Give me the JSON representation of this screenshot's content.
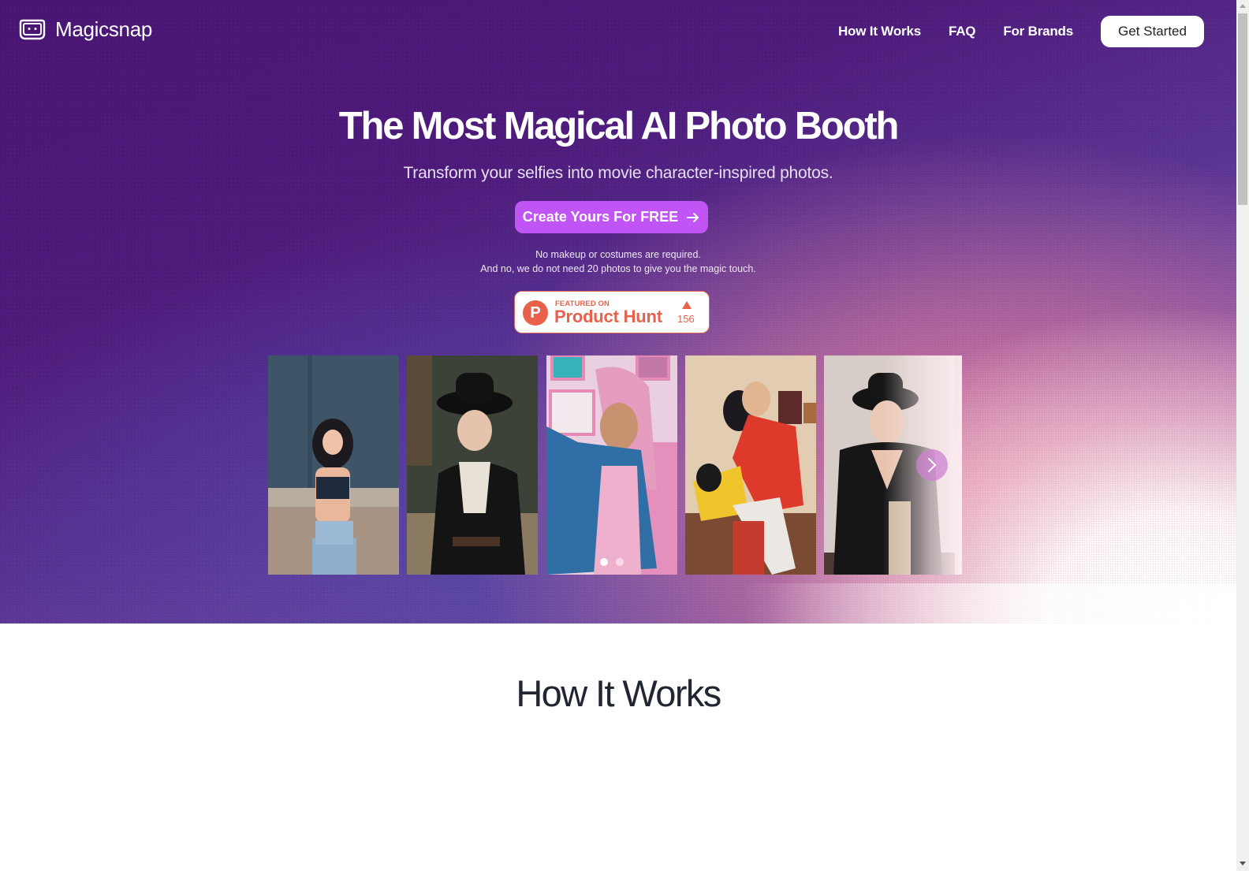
{
  "nav": {
    "brand": "Magicsnap",
    "links": [
      "How It Works",
      "FAQ",
      "For Brands"
    ],
    "cta": "Get Started"
  },
  "hero": {
    "title": "The Most Magical AI Photo Booth",
    "subtitle": "Transform your selfies into movie character-inspired photos.",
    "cta_label": "Create Yours For FREE",
    "cta_icon": "arrow-right-icon",
    "notes": [
      "No makeup or costumes are required.",
      "And no, we do not need 20 photos to give you the magic touch."
    ],
    "cta_color": "#c054f5"
  },
  "product_hunt": {
    "eyebrow": "FEATURED ON",
    "name": "Product Hunt",
    "logo_letter": "P",
    "upvotes": "156",
    "color": "#e9604b"
  },
  "gallery": {
    "photos": [
      {
        "alt": "Anime-style woman leaning against wall in crop top and jeans"
      },
      {
        "alt": "Woman in black hat and vintage black dress with white collar"
      },
      {
        "alt": "Man with long pink hair in denim jacket"
      },
      {
        "alt": "Anime-style family embrace in cozy room"
      },
      {
        "alt": "Woman in black hat and black wrap dress"
      }
    ],
    "pagination": {
      "total_pages": 2,
      "active_page": 1
    },
    "next_icon": "chevron-right-icon"
  },
  "how_it_works": {
    "title": "How It Works"
  }
}
